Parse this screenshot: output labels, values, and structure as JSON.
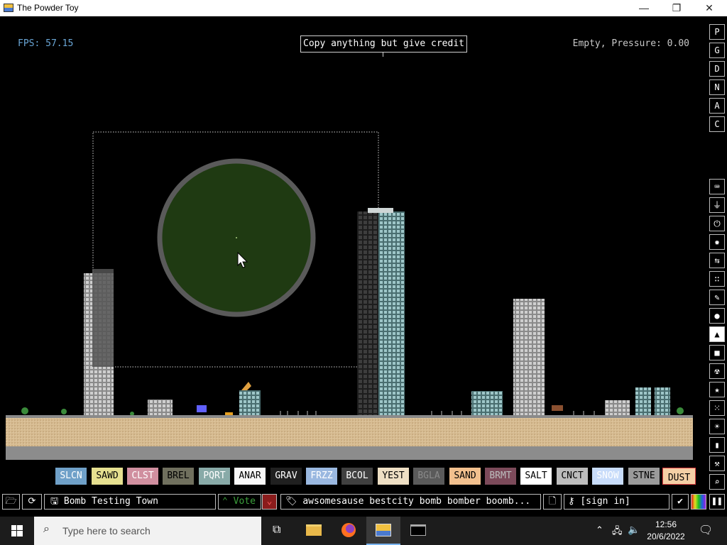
{
  "window": {
    "title": "The Powder Toy",
    "minimize_glyph": "—",
    "restore_glyph": "❐",
    "close_glyph": "✕"
  },
  "hud": {
    "fps": "FPS: 57.15",
    "sign_text": "Copy anything but give credit",
    "status": "Empty, Pressure: 0.00"
  },
  "right_toolbar": {
    "top_buttons": [
      "P",
      "G",
      "D",
      "N",
      "A",
      "C"
    ],
    "categories": [
      "keyboard-icon",
      "plug-icon",
      "power-icon",
      "explosive-icon",
      "arrows-icon",
      "gas-icon",
      "pencil-icon",
      "drop-icon",
      "powder-icon",
      "solid-icon",
      "radioactive-icon",
      "star-icon",
      "dots-icon",
      "bulb-icon",
      "bookmark-icon",
      "wrench-icon",
      "magnifier-icon"
    ],
    "selected_category_index": 8
  },
  "elements": [
    {
      "label": "SLCN",
      "color": "#6fa0c8",
      "text_color": "#ffffff"
    },
    {
      "label": "SAWD",
      "color": "#e6e090",
      "text_color": "#000000"
    },
    {
      "label": "CLST",
      "color": "#d08f9f",
      "text_color": "#ffffff"
    },
    {
      "label": "BREL",
      "color": "#70705e",
      "text_color": "#000000"
    },
    {
      "label": "PQRT",
      "color": "#88aaa8",
      "text_color": "#ffffff"
    },
    {
      "label": "ANAR",
      "color": "#f8f8f8",
      "text_color": "#000000"
    },
    {
      "label": "GRAV",
      "color": "#202020",
      "text_color": "#ffffff"
    },
    {
      "label": "FRZZ",
      "color": "#9ab8e0",
      "text_color": "#ffffff"
    },
    {
      "label": "BCOL",
      "color": "#404040",
      "text_color": "#ffffff"
    },
    {
      "label": "YEST",
      "color": "#eedfc4",
      "text_color": "#000000"
    },
    {
      "label": "BGLA",
      "color": "#5a5a5a",
      "text_color": "#8a8a8a"
    },
    {
      "label": "SAND",
      "color": "#f2c08e",
      "text_color": "#000000"
    },
    {
      "label": "BRMT",
      "color": "#7c4a5a",
      "text_color": "#bdbdbd"
    },
    {
      "label": "SALT",
      "color": "#ffffff",
      "text_color": "#000000"
    },
    {
      "label": "CNCT",
      "color": "#bdbdbd",
      "text_color": "#000000"
    },
    {
      "label": "SNOW",
      "color": "#c8dcfa",
      "text_color": "#ffffff"
    },
    {
      "label": "STNE",
      "color": "#9a9a9a",
      "text_color": "#000000"
    },
    {
      "label": "DUST",
      "color": "#f4d0a6",
      "text_color": "#000000"
    }
  ],
  "selected_element_index": 17,
  "bottom_bar": {
    "save_title": "Bomb Testing Town",
    "vote_label": "Vote",
    "tags": "awsomesause bestcity bomb bomber boomb...",
    "login": "[sign in]"
  },
  "taskbar": {
    "search_placeholder": "Type here to search",
    "time": "12:56",
    "date": "20/6/2022"
  },
  "colors": {
    "accent_fps": "#6aa6d6",
    "brush_fill": "#1f3a12",
    "brush_ring": "#5a5a5a",
    "ground": "#d2b48c",
    "vote_green": "#3ca03c",
    "vote_red": "#c03030",
    "taskbar_bg": "#1c1c1c"
  }
}
